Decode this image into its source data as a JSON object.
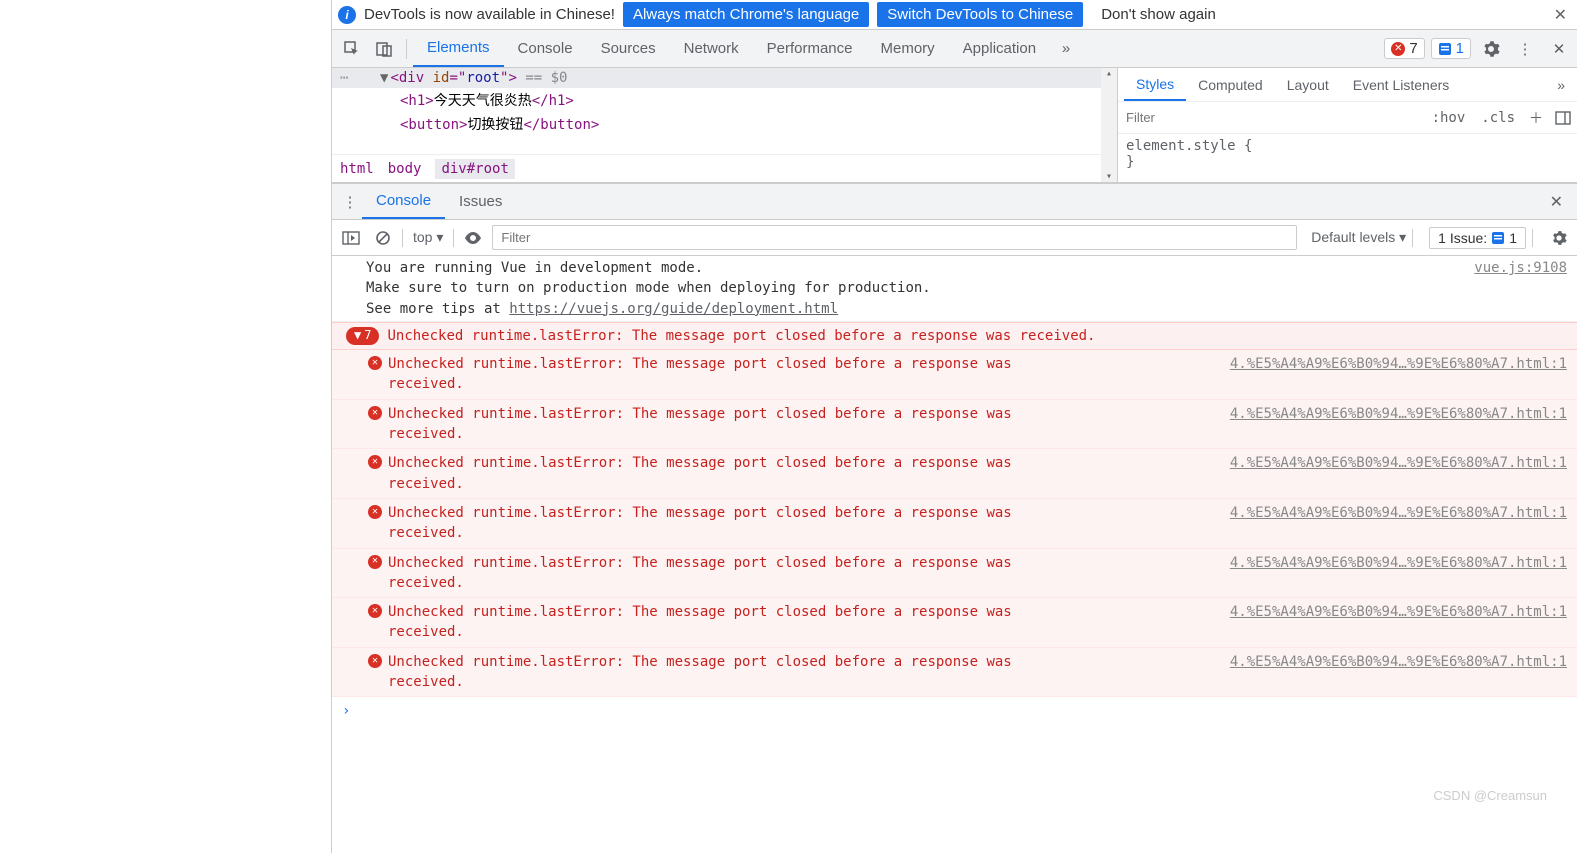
{
  "banner": {
    "msg": "DevTools is now available in Chinese!",
    "btn_match": "Always match Chrome's language",
    "btn_switch": "Switch DevTools to Chinese",
    "btn_dont": "Don't show again"
  },
  "tabs": {
    "elements": "Elements",
    "console": "Console",
    "sources": "Sources",
    "network": "Network",
    "performance": "Performance",
    "memory": "Memory",
    "application": "Application"
  },
  "badges": {
    "errors": "7",
    "issues": "1"
  },
  "dom": {
    "root_open": "<div id=\"root\">",
    "root_eq": "== $0",
    "h1_open": "<h1>",
    "h1_text": "今天天气很炎热",
    "h1_close": "</h1>",
    "btn_open": "<button>",
    "btn_text": "切换按钮",
    "btn_close": "</button>"
  },
  "crumbs": {
    "html": "html",
    "body": "body",
    "root": "div#root"
  },
  "styles": {
    "tabs": {
      "styles": "Styles",
      "computed": "Computed",
      "layout": "Layout",
      "listeners": "Event Listeners"
    },
    "filter_ph": "Filter",
    "hov": ":hov",
    "cls": ".cls",
    "rule": "element.style {",
    "rule2": "}"
  },
  "drawer": {
    "console": "Console",
    "issues": "Issues"
  },
  "ctoolbar": {
    "ctx": "top ▾",
    "filter_ph": "Filter",
    "levels": "Default levels ▾",
    "issue_label": "1 Issue:",
    "issue_n": "1"
  },
  "logs": {
    "vue1": "You are running Vue in development mode.",
    "vue2": "Make sure to turn on production mode when deploying for production.",
    "vue3": "See more tips at ",
    "vue_link": "https://vuejs.org/guide/deployment.html",
    "vue_src": "vue.js:9108",
    "group_n": "7",
    "group_msg": "Unchecked runtime.lastError: The message port closed before a response was received.",
    "err_msg": "Unchecked runtime.lastError: The message port closed before a response was received.",
    "err_src": "4.%E5%A4%A9%E6%B0%94…%9E%E6%80%A7.html:1"
  },
  "watermark": "CSDN @Creamsun"
}
